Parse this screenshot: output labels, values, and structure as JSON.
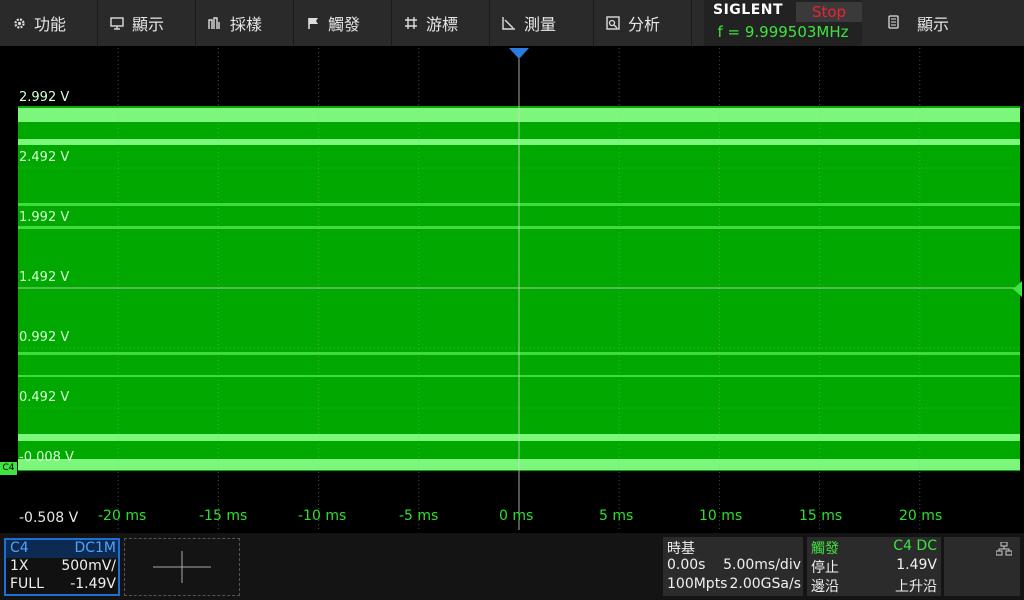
{
  "menu": [
    {
      "label": "功能",
      "icon": "gear-icon"
    },
    {
      "label": "顯示",
      "icon": "monitor-icon"
    },
    {
      "label": "採樣",
      "icon": "acquire-icon"
    },
    {
      "label": "觸發",
      "icon": "flag-icon"
    },
    {
      "label": "游標",
      "icon": "cursor-icon"
    },
    {
      "label": "測量",
      "icon": "measure-icon"
    },
    {
      "label": "分析",
      "icon": "analysis-icon"
    }
  ],
  "status": {
    "brand": "SIGLENT",
    "run_state": "Stop",
    "frequency": "f = 9.999503MHz"
  },
  "display_button": {
    "label": "顯示",
    "icon": "document-icon"
  },
  "y_axis_labels": [
    "2.992 V",
    "2.492 V",
    "1.992 V",
    "1.492 V",
    "0.992 V",
    "0.492 V",
    "-0.008 V",
    "-0.508 V"
  ],
  "x_axis_labels": [
    "-20 ms",
    "-15 ms",
    "-10 ms",
    "-5 ms",
    "0 ms",
    "5 ms",
    "10 ms",
    "15 ms",
    "20 ms"
  ],
  "channel_marker": "C4",
  "channel": {
    "name": "C4",
    "coupling": "DC1M",
    "probe": "1X",
    "scale": "500mV/",
    "bandwidth": "FULL",
    "offset": "-1.49V"
  },
  "timebase": {
    "title": "時基",
    "delay": "0.00s",
    "scale": "5.00ms/div",
    "memory": "100Mpts",
    "sample_rate": "2.00GSa/s"
  },
  "trigger": {
    "title": "觸發",
    "source": "C4 DC",
    "state": "停止",
    "level": "1.49V",
    "type": "邊沿",
    "slope": "上升沿"
  },
  "colors": {
    "trace": "#7cf77c",
    "fill": "#00a800",
    "channel_accent": "#1e6fd4",
    "run_state": "#e22233",
    "label_green": "#2fe02f"
  }
}
